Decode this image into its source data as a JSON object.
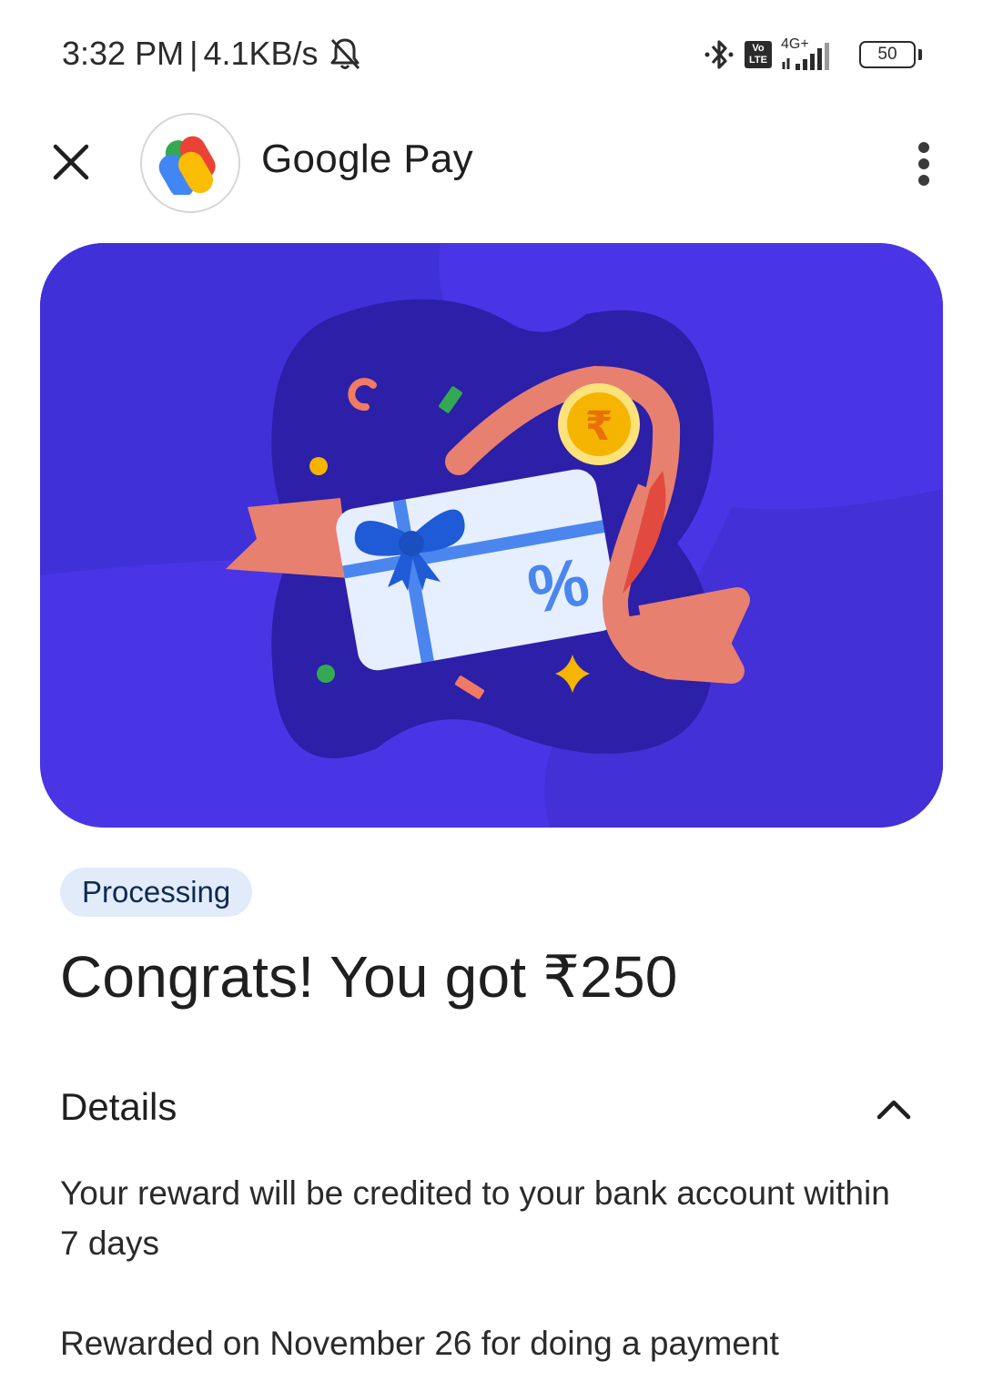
{
  "status_bar": {
    "time": "3:32 PM",
    "separator": "|",
    "speed": "4.1KB/s",
    "network_label": "4G+",
    "volte_top": "Vo",
    "volte_bottom": "LTE",
    "battery": "50",
    "icons": [
      "mute-bell-icon",
      "bluetooth-icon",
      "volte-icon",
      "signal-icon",
      "battery-icon"
    ]
  },
  "app_bar": {
    "title": "Google Pay",
    "close_icon": "close-icon",
    "more_icon": "more-vert-icon"
  },
  "banner": {
    "illustration": "gift-card-reward",
    "percent_symbol": "%",
    "rupee_symbol": "₹",
    "colors": {
      "background": "#4a35e6",
      "blob": "#2c1fa8",
      "card": "#e6efff",
      "ribbon": "#e8806f",
      "bow": "#1f5bd6",
      "coin": "#f5b400"
    }
  },
  "reward": {
    "status": "Processing",
    "headline": "Congrats! You got ₹250"
  },
  "details": {
    "title": "Details",
    "expanded": true,
    "credit_note": "Your reward will be credited to your bank account within 7 days",
    "reward_note": "Rewarded on November 26 for doing a payment"
  }
}
